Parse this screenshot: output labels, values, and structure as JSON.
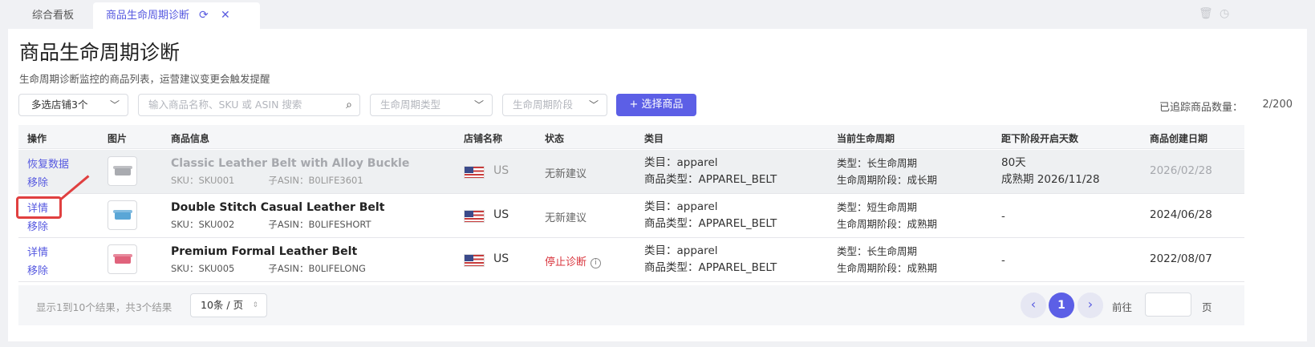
{
  "tabs": [
    {
      "label": "综合看板"
    },
    {
      "label": "商品生命周期诊断"
    }
  ],
  "page": {
    "title": "商品生命周期诊断",
    "subtitle": "生命周期诊断监控的商品列表，运营建议变更会触发提醒"
  },
  "filters": {
    "store_select": "多选店铺3个",
    "search_placeholder": "输入商品名称、SKU 或 ASIN 搜索",
    "lifecycle_type_placeholder": "生命周期类型",
    "lifecycle_stage_placeholder": "生命周期阶段",
    "select_button": "+ 选择商品",
    "tracked_label": "已追踪商品数量：",
    "tracked_value": "2/200"
  },
  "table": {
    "headers": [
      "操作",
      "图片",
      "商品信息",
      "店铺名称",
      "状态",
      "类目",
      "当前生命周期",
      "距下阶段开启天数",
      "商品创建日期"
    ],
    "rows": [
      {
        "action1": "恢复数据",
        "action2": "移除",
        "name": "Classic Leather Belt with Alloy Buckle",
        "sku": "SKU：SKU001",
        "asin": "子ASIN：B0LIFE3601",
        "country": "US",
        "status": "无新建议",
        "category": "类目：apparel",
        "product_type": "商品类型：APPAREL_BELT",
        "lc_type": "类型：长生命周期",
        "lc_stage": "生命周期阶段：成长期",
        "days1": "80天",
        "days2": "成熟期 2026/11/28",
        "date": "2026/02/28",
        "thumb_color": "#a9abb0"
      },
      {
        "action1": "详情",
        "action2": "移除",
        "name": "Double Stitch Casual Leather Belt",
        "sku": "SKU：SKU002",
        "asin": "子ASIN：B0LIFESHORT",
        "country": "US",
        "status": "无新建议",
        "category": "类目：apparel",
        "product_type": "商品类型：APPAREL_BELT",
        "lc_type": "类型：短生命周期",
        "lc_stage": "生命周期阶段：成熟期",
        "days1": "-",
        "days2": "",
        "date": "2024/06/28",
        "thumb_color": "#5aa6d6"
      },
      {
        "action1": "详情",
        "action2": "移除",
        "name": "Premium Formal Leather Belt",
        "sku": "SKU：SKU005",
        "asin": "子ASIN：B0LIFELONG",
        "country": "US",
        "status": "停止诊断",
        "category": "类目：apparel",
        "product_type": "商品类型：APPAREL_BELT",
        "lc_type": "类型：长生命周期",
        "lc_stage": "生命周期阶段：成熟期",
        "days1": "-",
        "days2": "",
        "date": "2022/08/07",
        "thumb_color": "#e0637c"
      }
    ]
  },
  "footer": {
    "info": "显示1到10个结果，共3个结果",
    "page_size": "10条 / 页",
    "current_page": "1",
    "goto_label": "前往",
    "page_unit": "页"
  },
  "colors": {
    "accent": "#5c5fe6",
    "danger": "#d9363e"
  }
}
